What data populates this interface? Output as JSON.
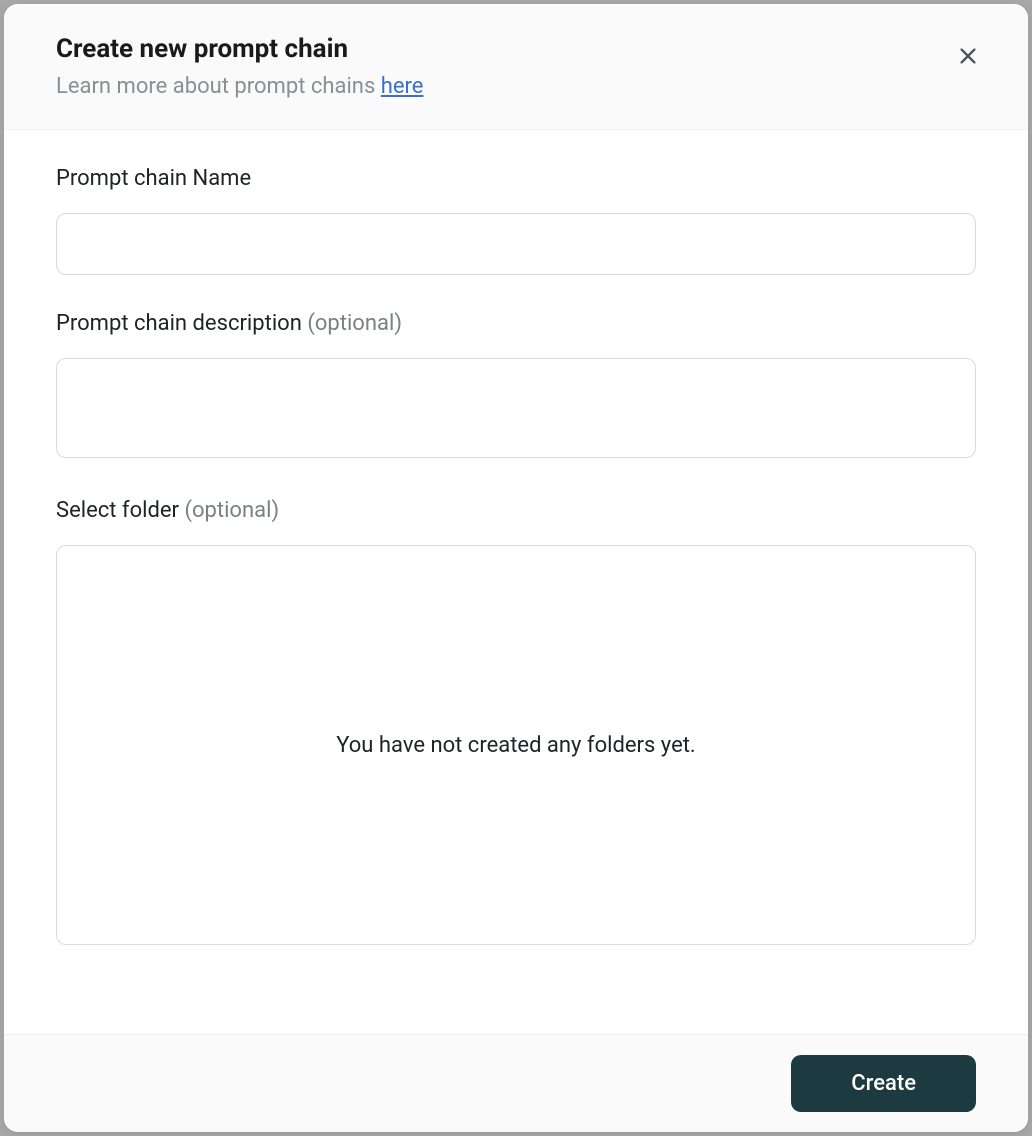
{
  "header": {
    "title": "Create new prompt chain",
    "subtitle_prefix": "Learn more about prompt chains ",
    "subtitle_link": "here"
  },
  "form": {
    "name": {
      "label": "Prompt chain Name",
      "value": ""
    },
    "description": {
      "label_main": "Prompt chain description ",
      "label_optional": "(optional)",
      "value": ""
    },
    "folder": {
      "label_main": "Select folder ",
      "label_optional": "(optional)",
      "empty_text": "You have not created any folders yet."
    }
  },
  "footer": {
    "create_label": "Create"
  }
}
